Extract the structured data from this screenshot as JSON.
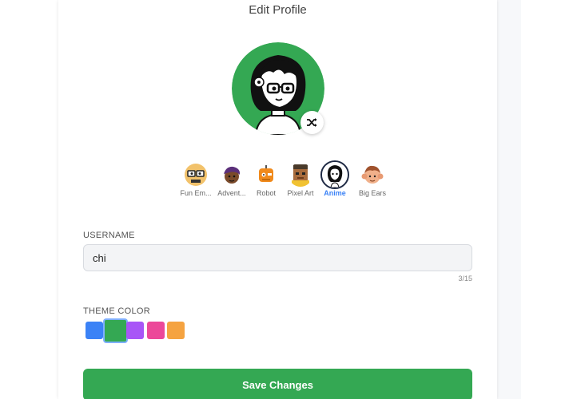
{
  "page": {
    "title": "Edit Profile"
  },
  "avatar": {
    "background_color": "#34a853",
    "shuffle_icon": "shuffle-icon"
  },
  "avatar_styles": [
    {
      "label": "Fun Em...",
      "icon": "nerd-emoji-avatar-icon",
      "active": false
    },
    {
      "label": "Advent...",
      "icon": "adventurer-avatar-icon",
      "active": false
    },
    {
      "label": "Robot",
      "icon": "robot-avatar-icon",
      "active": false
    },
    {
      "label": "Pixel Art",
      "icon": "pixel-art-avatar-icon",
      "active": false
    },
    {
      "label": "Anime",
      "icon": "anime-avatar-icon",
      "active": true
    },
    {
      "label": "Big Ears",
      "icon": "big-ears-avatar-icon",
      "active": false
    }
  ],
  "username": {
    "label": "USERNAME",
    "value": "chi",
    "counter": "3/15"
  },
  "theme": {
    "label": "THEME COLOR",
    "colors": [
      "#3b82f6",
      "#34a853",
      "#a855f7",
      "#ec4899",
      "#f5a340"
    ],
    "selected": 1
  },
  "actions": {
    "save_label": "Save Changes"
  }
}
